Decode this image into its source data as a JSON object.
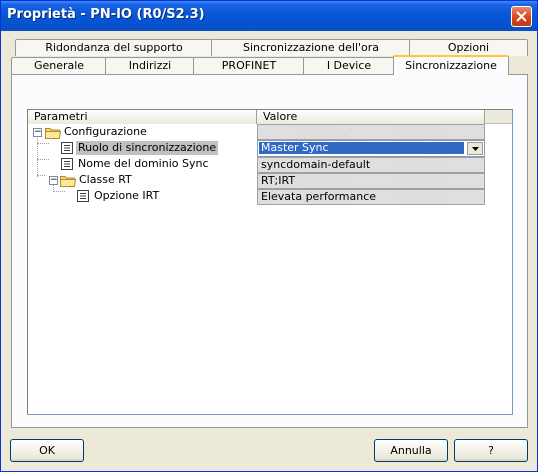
{
  "window": {
    "title": "Proprietà - PN-IO (R0/S2.3)"
  },
  "tabs_row1": [
    {
      "label": "Ridondanza del supporto"
    },
    {
      "label": "Sincronizzazione dell'ora"
    },
    {
      "label": "Opzioni"
    }
  ],
  "tabs_row2": [
    {
      "label": "Generale"
    },
    {
      "label": "Indirizzi"
    },
    {
      "label": "PROFINET"
    },
    {
      "label": "I Device"
    },
    {
      "label": "Sincronizzazione",
      "active": true
    }
  ],
  "table": {
    "columns": [
      "Parametri",
      "Valore"
    ],
    "rows": [
      {
        "label": "Configurazione",
        "value": "",
        "icon": "folder-icon",
        "expanded": true
      },
      {
        "label": "Ruolo di sincronizzazione",
        "value": "Master Sync",
        "icon": "parameter-icon",
        "selected": true
      },
      {
        "label": "Nome del dominio Sync",
        "value": "syncdomain-default",
        "icon": "parameter-icon"
      },
      {
        "label": "Classe RT",
        "value": "RT;IRT",
        "icon": "folder-icon",
        "expanded": true
      },
      {
        "label": "Opzione IRT",
        "value": "Elevata performance",
        "icon": "parameter-icon"
      }
    ]
  },
  "buttons": {
    "ok": "OK",
    "cancel": "Annulla",
    "help": "?"
  },
  "colors": {
    "titlebar": "#0a58d6",
    "selection": "#316ac5",
    "active_tab_accent": "#ffc83c"
  }
}
